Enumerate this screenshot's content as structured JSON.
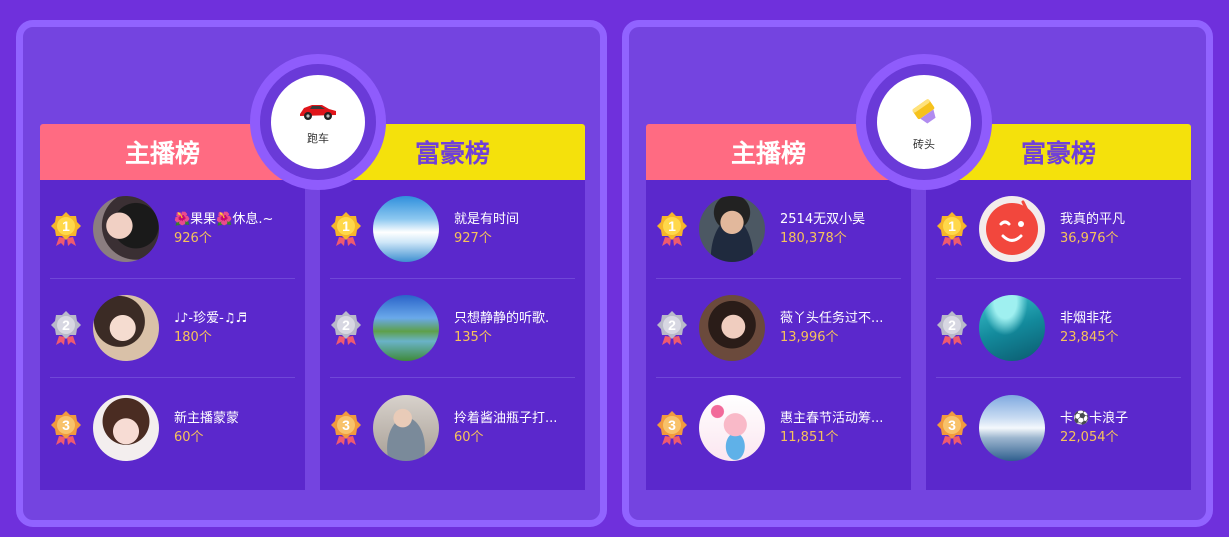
{
  "colors": {
    "page_bg": "#6f30dc",
    "panel_bg": "#7444e0",
    "panel_border": "#9163ff",
    "anchor_header": "#ff6b82",
    "rich_header": "#f4e10c",
    "list_bg": "#5b28cc",
    "count_text": "#f7c35a"
  },
  "panels": [
    {
      "gift": {
        "name": "跑车",
        "icon": "sports-car-icon"
      },
      "anchor_title": "主播榜",
      "rich_title": "富豪榜",
      "anchor": [
        {
          "rank": "1",
          "name": "🌺果果🌺休息.~",
          "count": "926个"
        },
        {
          "rank": "2",
          "name": "♩♪-珍爱-♫♬",
          "count": "180个"
        },
        {
          "rank": "3",
          "name": "新主播蒙蒙",
          "count": "60个"
        }
      ],
      "rich": [
        {
          "rank": "1",
          "name": "就是有时间",
          "count": "927个"
        },
        {
          "rank": "2",
          "name": "只想静静的听歌.",
          "count": "135个"
        },
        {
          "rank": "3",
          "name": "拎着酱油瓶子打...",
          "count": "60个"
        }
      ]
    },
    {
      "gift": {
        "name": "砖头",
        "icon": "brick-icon"
      },
      "anchor_title": "主播榜",
      "rich_title": "富豪榜",
      "anchor": [
        {
          "rank": "1",
          "name": "2514无双小昊",
          "count": "180,378个"
        },
        {
          "rank": "2",
          "name": "薇丫头任务过不...",
          "count": "13,996个"
        },
        {
          "rank": "3",
          "name": "惠主春节活动筹...",
          "count": "11,851个"
        }
      ],
      "rich": [
        {
          "rank": "1",
          "name": "我真的平凡",
          "count": "36,976个"
        },
        {
          "rank": "2",
          "name": "非烟非花",
          "count": "23,845个"
        },
        {
          "rank": "3",
          "name": "卡⚽卡浪子",
          "count": "22,054个"
        }
      ]
    }
  ]
}
